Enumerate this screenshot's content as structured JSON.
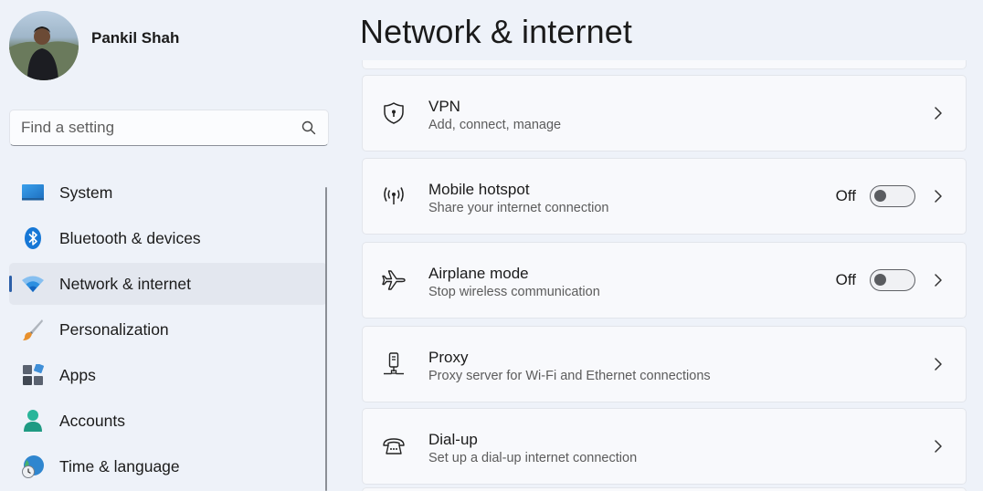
{
  "profile": {
    "name": "Pankil Shah"
  },
  "search": {
    "placeholder": "Find a setting"
  },
  "nav": {
    "items": [
      {
        "label": "System",
        "icon": "system-icon"
      },
      {
        "label": "Bluetooth & devices",
        "icon": "bluetooth-icon"
      },
      {
        "label": "Network & internet",
        "icon": "wifi-icon",
        "selected": true
      },
      {
        "label": "Personalization",
        "icon": "brush-icon"
      },
      {
        "label": "Apps",
        "icon": "apps-icon"
      },
      {
        "label": "Accounts",
        "icon": "person-icon"
      },
      {
        "label": "Time & language",
        "icon": "globe-clock-icon"
      }
    ]
  },
  "main": {
    "title": "Network & internet",
    "cards": [
      {
        "title": "VPN",
        "subtitle": "Add, connect, manage",
        "icon": "shield-icon"
      },
      {
        "title": "Mobile hotspot",
        "subtitle": "Share your internet connection",
        "icon": "hotspot-icon",
        "toggle_state": "Off"
      },
      {
        "title": "Airplane mode",
        "subtitle": "Stop wireless communication",
        "icon": "airplane-icon",
        "toggle_state": "Off"
      },
      {
        "title": "Proxy",
        "subtitle": "Proxy server for Wi-Fi and Ethernet connections",
        "icon": "proxy-icon"
      },
      {
        "title": "Dial-up",
        "subtitle": "Set up a dial-up internet connection",
        "icon": "dialup-icon"
      }
    ]
  },
  "colors": {
    "accent": "#2c5fa8",
    "background": "#eef2f9",
    "card": "#f8f9fc"
  }
}
